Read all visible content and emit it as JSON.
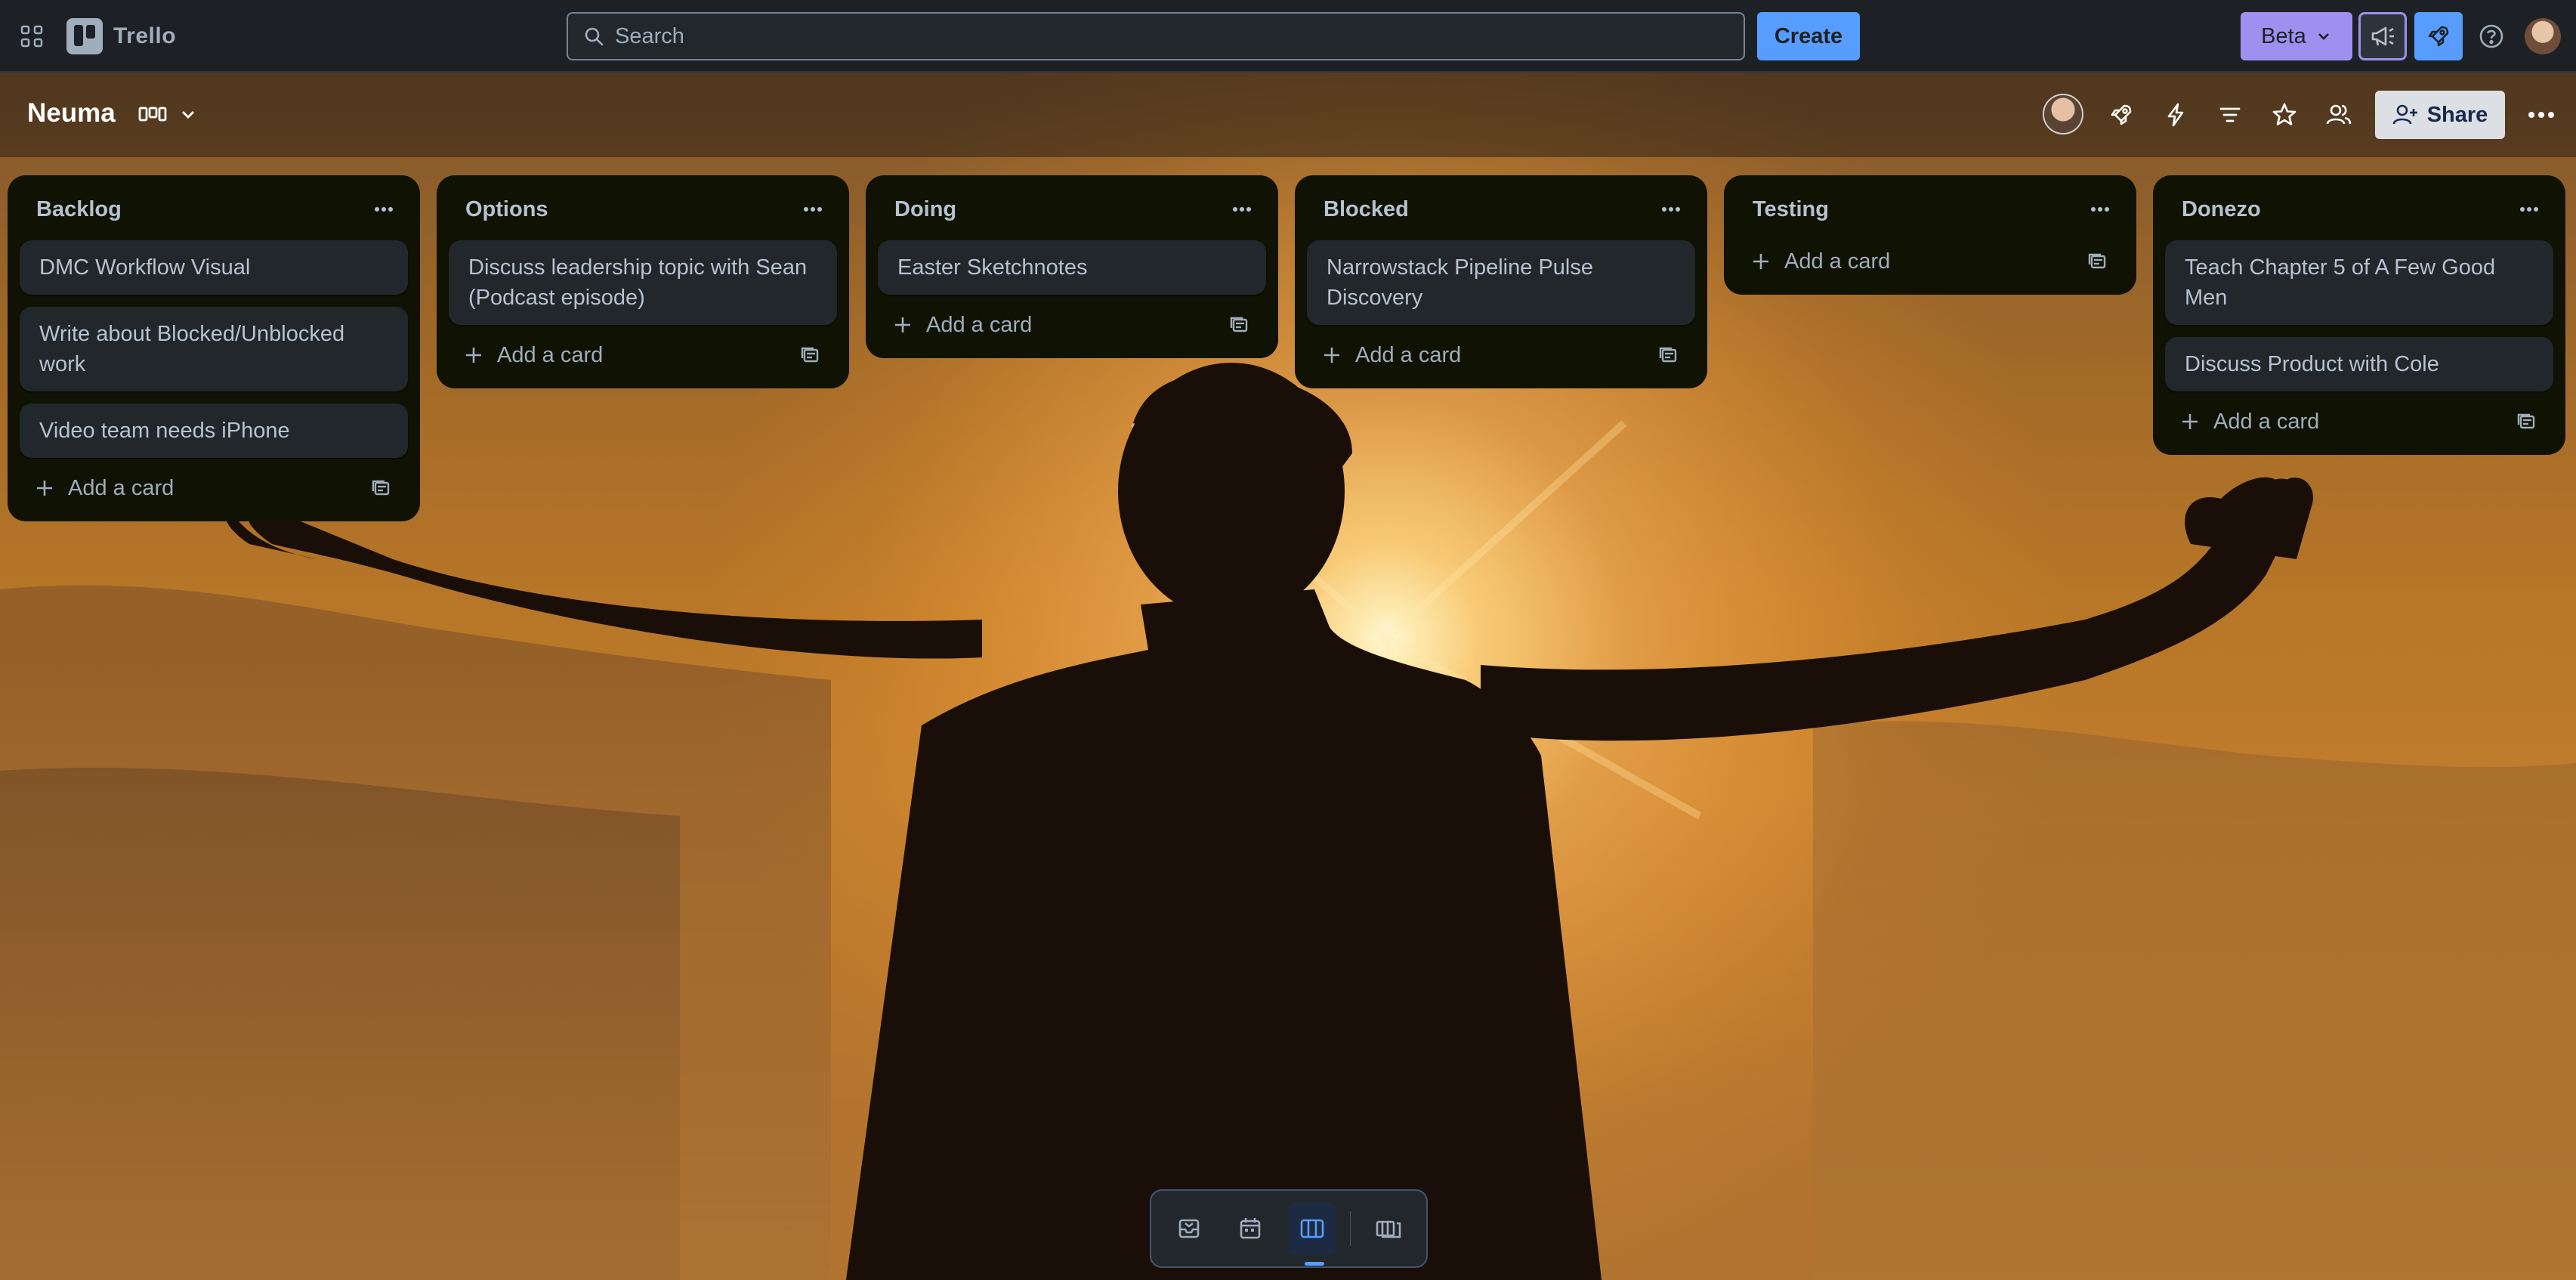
{
  "topbar": {
    "app_name": "Trello",
    "search_placeholder": "Search",
    "create_label": "Create",
    "beta_label": "Beta"
  },
  "board": {
    "title": "Neuma",
    "share_label": "Share"
  },
  "lists": [
    {
      "title": "Backlog",
      "cards": [
        "DMC Workflow Visual",
        "Write about Blocked/Unblocked work",
        "Video team needs iPhone"
      ],
      "add_label": "Add a card"
    },
    {
      "title": "Options",
      "cards": [
        "Discuss leadership topic with Sean (Podcast episode)"
      ],
      "add_label": "Add a card"
    },
    {
      "title": "Doing",
      "cards": [
        "Easter Sketchnotes"
      ],
      "add_label": "Add a card"
    },
    {
      "title": "Blocked",
      "cards": [
        "Narrowstack Pipeline Pulse Discovery"
      ],
      "add_label": "Add a card"
    },
    {
      "title": "Testing",
      "cards": [],
      "add_label": "Add a card"
    },
    {
      "title": "Donezo",
      "cards": [
        "Teach Chapter 5 of A Few Good Men",
        "Discuss Product with Cole"
      ],
      "add_label": "Add a card"
    }
  ],
  "icons": {
    "apps": "grid-icon",
    "search": "search-icon",
    "announcements": "megaphone-icon",
    "rocket": "rocket-icon",
    "help": "help-icon",
    "views": [
      "inbox-icon",
      "calendar-icon",
      "board-icon",
      "switch-board-icon"
    ]
  },
  "colors": {
    "accent": "#579dff",
    "beta": "#9f8fef",
    "list_bg": "#101204",
    "card_bg": "#22272b"
  }
}
